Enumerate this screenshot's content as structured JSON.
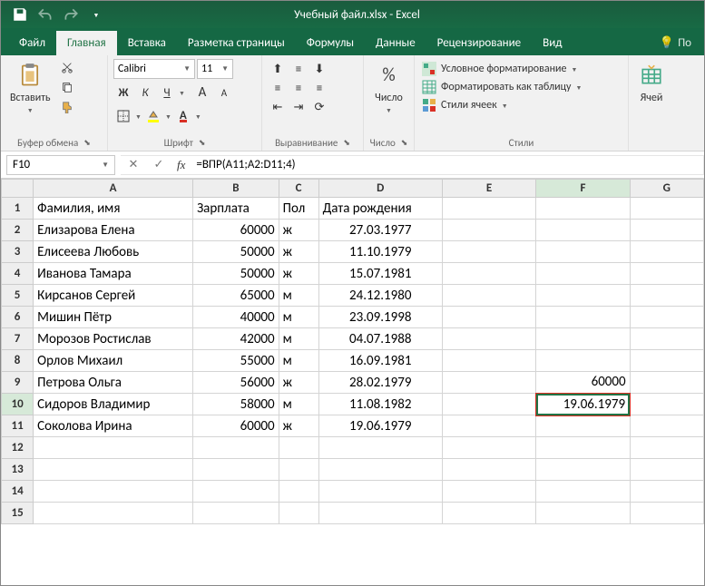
{
  "app_title": "Учебный файл.xlsx - Excel",
  "tabs": {
    "file": "Файл",
    "home": "Главная",
    "insert": "Вставка",
    "page_layout": "Разметка страницы",
    "formulas": "Формулы",
    "data": "Данные",
    "review": "Рецензирование",
    "view": "Вид",
    "tell_me": "По"
  },
  "ribbon": {
    "clipboard": {
      "paste": "Вставить",
      "title": "Буфер обмена"
    },
    "font": {
      "name": "Calibri",
      "size": "11",
      "bold": "Ж",
      "italic": "К",
      "under": "Ч",
      "grow": "A",
      "shrink": "A",
      "title": "Шрифт"
    },
    "alignment": {
      "title": "Выравнивание"
    },
    "number": {
      "btn": "Число",
      "title": "Число"
    },
    "styles": {
      "cond": "Условное форматирование",
      "table": "Форматировать как таблицу",
      "cell": "Стили ячеек",
      "title": "Стили"
    },
    "cells": {
      "btn": "Ячей"
    }
  },
  "namebox": "F10",
  "fx_label": "fx",
  "formula": "=ВПР(A11;A2:D11;4)",
  "columns": [
    "A",
    "B",
    "C",
    "D",
    "E",
    "F",
    "G"
  ],
  "rows": [
    "1",
    "2",
    "3",
    "4",
    "5",
    "6",
    "7",
    "8",
    "9",
    "10",
    "11",
    "12",
    "13",
    "14",
    "15"
  ],
  "data": {
    "r1": {
      "A": "Фамилия, имя",
      "B": "Зарплата",
      "C": "Пол",
      "D": "Дата рождения"
    },
    "r2": {
      "A": "Елизарова Елена",
      "B": "60000",
      "C": "ж",
      "D": "27.03.1977"
    },
    "r3": {
      "A": "Елисеева Любовь",
      "B": "50000",
      "C": "ж",
      "D": "11.10.1979"
    },
    "r4": {
      "A": "Иванова Тамара",
      "B": "50000",
      "C": "ж",
      "D": "15.07.1981"
    },
    "r5": {
      "A": "Кирсанов Сергей",
      "B": "65000",
      "C": "м",
      "D": "24.12.1980"
    },
    "r6": {
      "A": "Мишин Пётр",
      "B": "40000",
      "C": "м",
      "D": "23.09.1998"
    },
    "r7": {
      "A": "Морозов Ростислав",
      "B": "42000",
      "C": "м",
      "D": "04.07.1988"
    },
    "r8": {
      "A": "Орлов Михаил",
      "B": "55000",
      "C": "м",
      "D": "16.09.1981"
    },
    "r9": {
      "A": "Петрова Ольга",
      "B": "56000",
      "C": "ж",
      "D": "28.02.1979",
      "F": "60000"
    },
    "r10": {
      "A": "Сидоров Владимир",
      "B": "58000",
      "C": "м",
      "D": "11.08.1982",
      "F": "19.06.1979"
    },
    "r11": {
      "A": "Соколова Ирина",
      "B": "60000",
      "C": "ж",
      "D": "19.06.1979"
    }
  },
  "selected_cell": "F10",
  "highlighted_cell": "F10"
}
